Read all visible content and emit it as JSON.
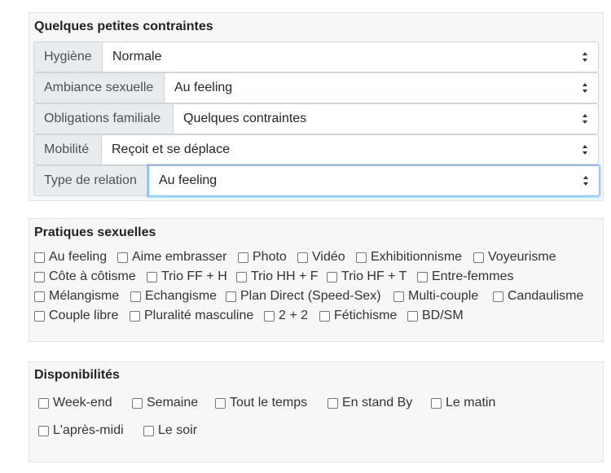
{
  "constraints": {
    "title": "Quelques petites contraintes",
    "rows": [
      {
        "label": "Hygiène",
        "value": "Normale"
      },
      {
        "label": "Ambiance sexuelle",
        "value": "Au feeling"
      },
      {
        "label": "Obligations familiale",
        "value": "Quelques contraintes"
      },
      {
        "label": "Mobilité",
        "value": "Reçoit et se déplace"
      },
      {
        "label": "Type de relation",
        "value": "Au feeling"
      }
    ]
  },
  "practices": {
    "title": "Pratiques sexuelles",
    "items": [
      "Au feeling",
      "Aime embrasser",
      "Photo",
      "Vidéo",
      "Exhibitionnisme",
      "Voyeurisme",
      "Côte à côtisme",
      "Trio FF + H",
      "Trio HH + F",
      "Trio HF + T",
      "Entre-femmes",
      "Mélangisme",
      "Echangisme",
      "Plan Direct (Speed-Sex)",
      "Multi-couple",
      "Candaulisme",
      "Couple libre",
      "Pluralité masculine",
      "2 + 2",
      "Fétichisme",
      "BD/SM"
    ]
  },
  "availability": {
    "title": "Disponibilités",
    "items": [
      "Week-end",
      "Semaine",
      "Tout le temps",
      "En stand By",
      "Le matin",
      "L'après-midi",
      "Le soir"
    ]
  }
}
